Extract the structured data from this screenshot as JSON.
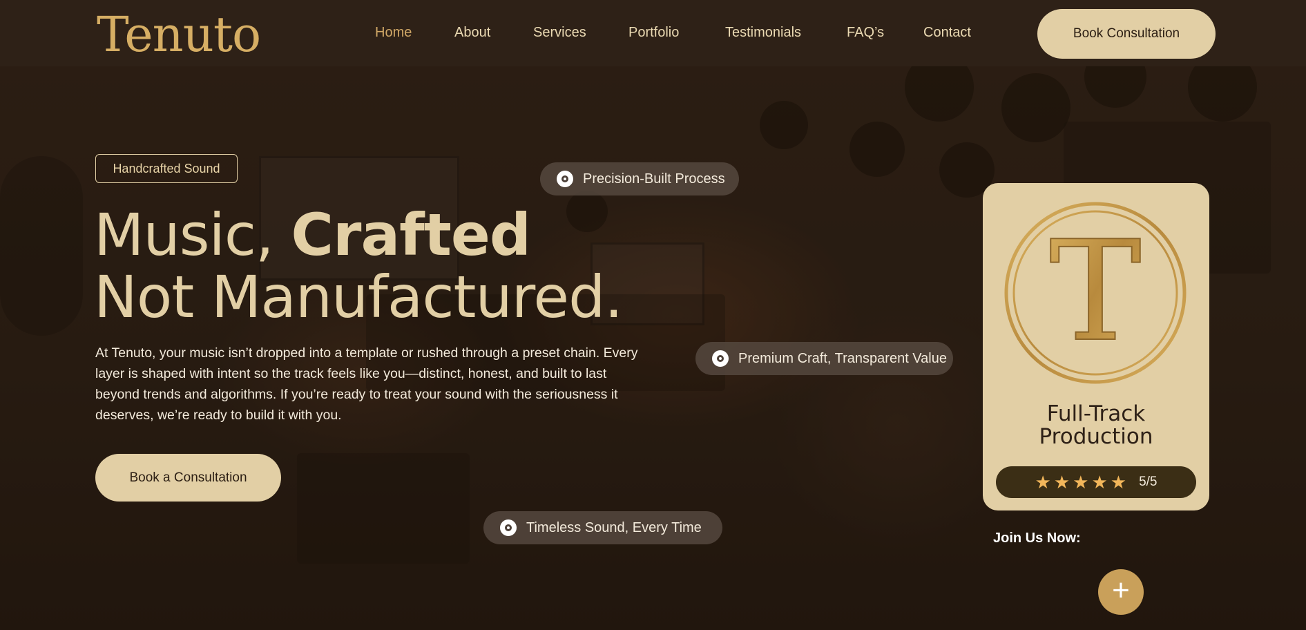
{
  "brand": {
    "logo_text": "Tenuto"
  },
  "nav": {
    "items": [
      {
        "label": "Home",
        "active": true
      },
      {
        "label": "About"
      },
      {
        "label": "Services"
      },
      {
        "label": "Portfolio"
      },
      {
        "label": "Testimonials"
      },
      {
        "label": "FAQ’s"
      },
      {
        "label": "Contact"
      }
    ],
    "cta_label": "Book Consultation"
  },
  "hero": {
    "tag": "Handcrafted Sound",
    "headline_part1": "Music, ",
    "headline_bold": "Crafted",
    "headline_line2": "Not Manufactured.",
    "description": "At Tenuto, your music isn’t dropped into a template or rushed through a preset chain. Every layer is shaped with intent so the track feels like you—distinct, honest, and built to last beyond trends and algorithms. If you’re ready to treat your sound with the seriousness it deserves, we’re ready to build it with you.",
    "cta_label": "Book a Consultation"
  },
  "pills": [
    {
      "label": "Precision-Built Process",
      "icon": "disc-icon"
    },
    {
      "label": "Premium Craft, Transparent Value",
      "icon": "disc-icon"
    },
    {
      "label": "Timeless Sound, Every Time",
      "icon": "disc-icon"
    }
  ],
  "card": {
    "emblem_letter": "T",
    "title_line1": "Full-Track",
    "title_line2": "Production",
    "rating_stars": 5,
    "rating_text": "5/5"
  },
  "join": {
    "label": "Join Us Now:",
    "button_icon": "plus-icon"
  },
  "colors": {
    "background": "#2b1e13",
    "accent": "#e2cfa5",
    "gold": "#d6ae64",
    "star": "#f2b65a"
  }
}
